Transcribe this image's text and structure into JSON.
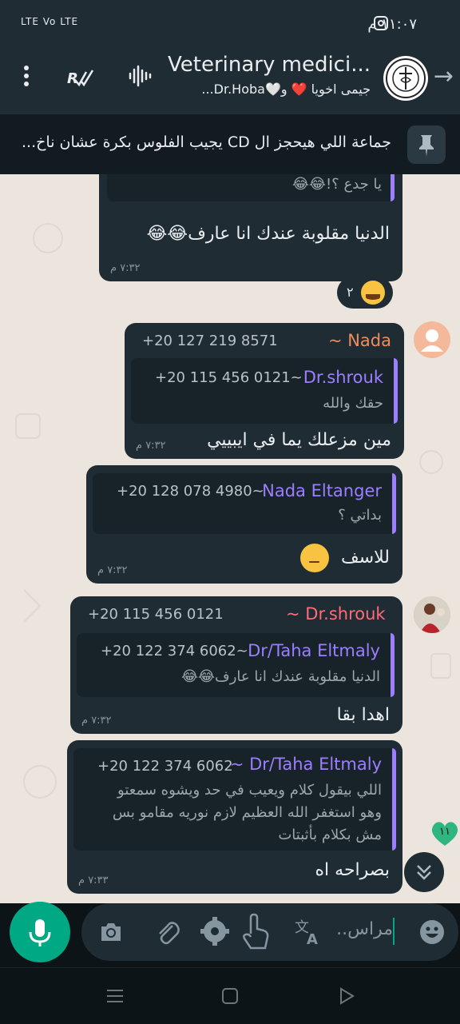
{
  "status_bar": {
    "time": "١١:٠٧ م",
    "signal": "LTE Vo LTE"
  },
  "header": {
    "title": "Veterinary medici...",
    "subtitle": "جيمى اخويا ❤️ و🤍Dr.Hoba..."
  },
  "pinned": {
    "text": "جماعة اللي هيحجز ال CD يجيب الفلوس بكرة عشان ناخ..."
  },
  "messages": [
    {
      "quote_text": "يا جدع ؟!😂😂",
      "body": "الدنيا مقلوبة عندك انا عارف😂😂",
      "time": "٧:٣٢ م",
      "reaction_count": "٢"
    },
    {
      "sender_name": "~ Nada",
      "sender_phone": "+20 127 219 8571",
      "quote_name": "Dr.shrouk",
      "quote_phone": "+20 115 456 0121~",
      "quote_text": "حقك والله",
      "body": "مين مزعلك يما في ايبييي",
      "time": "٧:٣٢ م"
    },
    {
      "quote_name": "Nada Eltanger",
      "quote_phone": "+20 128 078 4980~",
      "quote_text": "بداتي ؟",
      "body": "للاسف",
      "time": "٧:٣٢ م"
    },
    {
      "sender_name": "~ Dr.shrouk",
      "sender_phone": "+20 115 456 0121",
      "quote_name": "Dr/Taha Eltmaly",
      "quote_phone": "+20 122 374 6062~",
      "quote_text": "الدنيا مقلوبة عندك انا عارف😂😂",
      "body": "اهدا بقا",
      "time": "٧:٣٢ م"
    },
    {
      "sender_name": "~ Dr/Taha Eltmaly",
      "sender_phone": "+20 122 374 6062",
      "body_lines": [
        "اللي بيقول كلام ويعيب في حد ويشوه سمعتو",
        "وهو استغفر الله العظيم لازم نوريه مقامو بس",
        "مش بكلام بأثبتات"
      ],
      "body": "بصراحه اه",
      "time": "٧:٣٣ م"
    }
  ],
  "unread_count": "١١",
  "input": {
    "placeholder": "مراس.."
  },
  "colors": {
    "accent": "#00a884",
    "bubble": "#1f2c34",
    "quote_bar": "#9c7fff",
    "nada_name": "#f08c5a",
    "shrouk_name": "#ff6b7a",
    "taha_name": "#9c7fff",
    "chat_bg": "#ece5dd"
  }
}
